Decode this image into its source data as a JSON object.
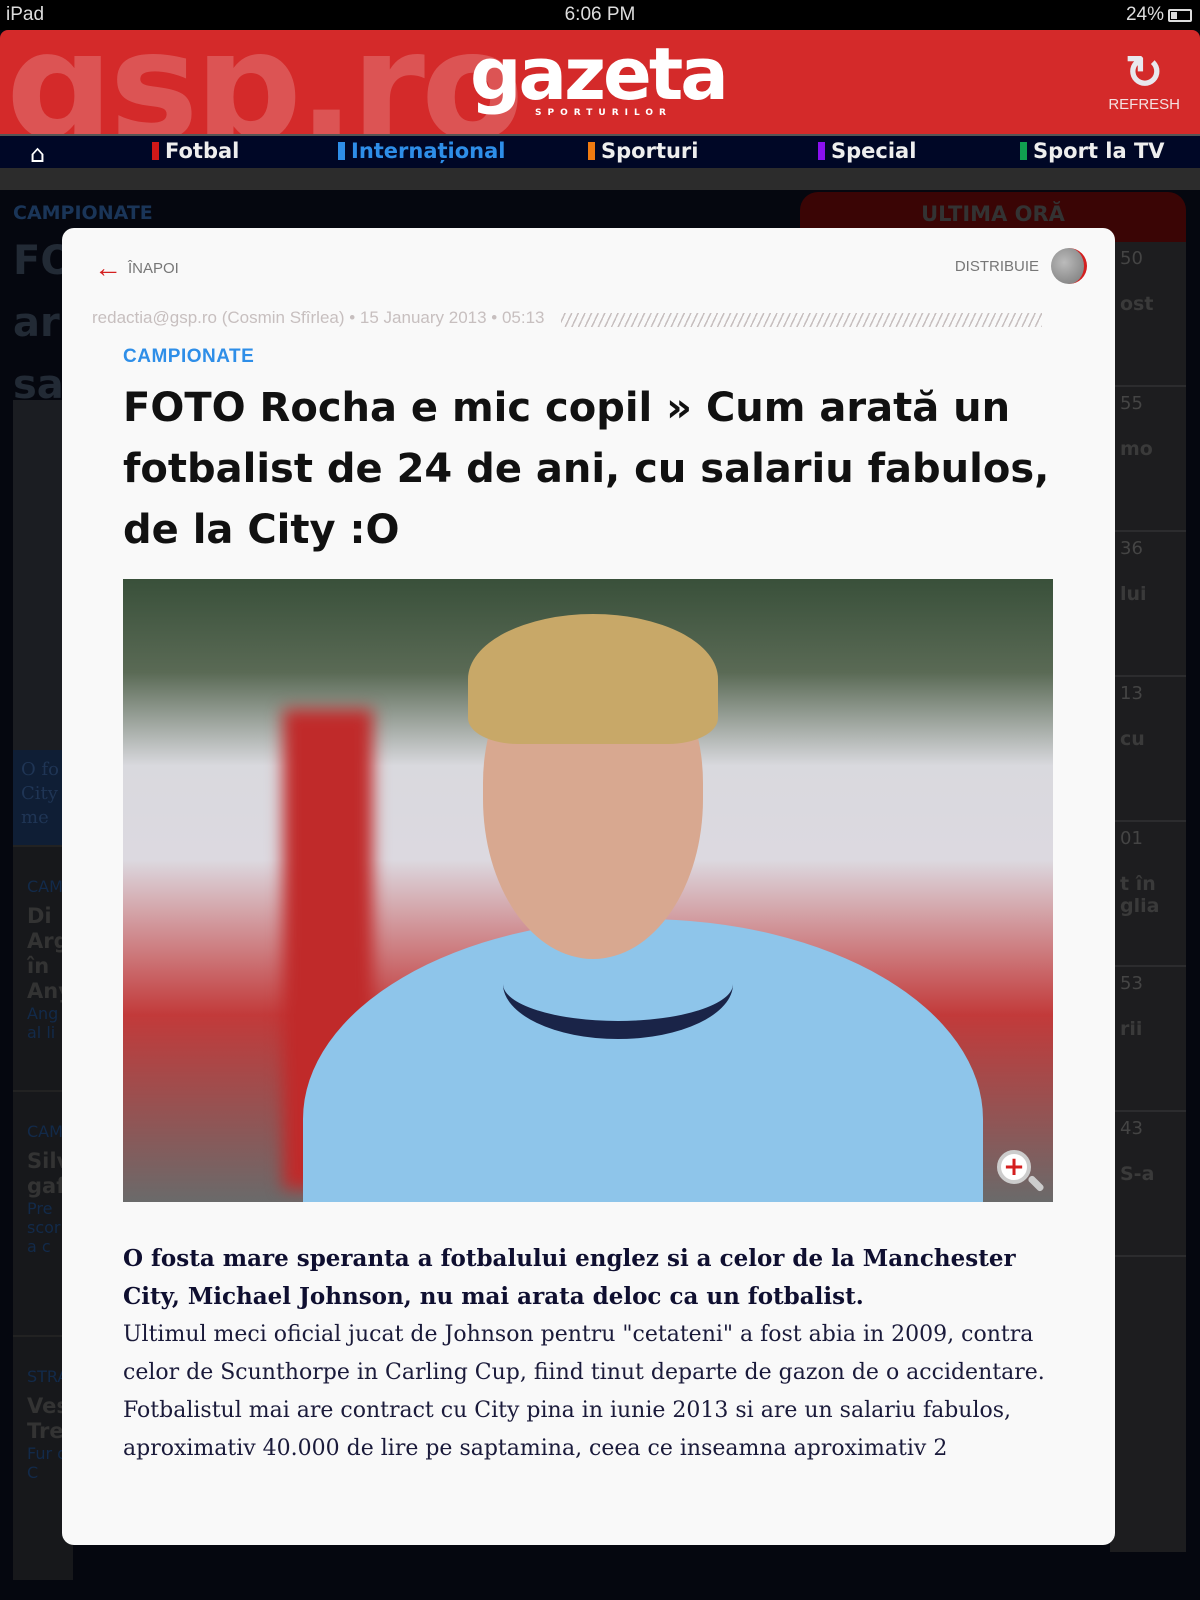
{
  "status": {
    "device": "iPad",
    "time": "6:06 PM",
    "battery": "24%"
  },
  "header": {
    "watermark": "gsp.ro",
    "logo": "gazeta",
    "logo_sub": "SPORTURILOR",
    "refresh_label": "REFRESH"
  },
  "nav": {
    "items": [
      {
        "label": "Fotbal",
        "color": "#d01818"
      },
      {
        "label": "Internațional",
        "color": "#2e8ee8"
      },
      {
        "label": "Sporturi",
        "color": "#f07a10"
      },
      {
        "label": "Special",
        "color": "#8a10f0"
      },
      {
        "label": "Sport la TV",
        "color": "#10a050"
      }
    ]
  },
  "background": {
    "category": "CAMPIONATE",
    "title": "FO\nar\nsa",
    "ultima_ora": "ULTIMA ORĂ",
    "latest": [
      {
        "time": "50",
        "text": "ost"
      },
      {
        "time": "55",
        "text": "mo"
      },
      {
        "time": "36",
        "text": "lui"
      },
      {
        "time": "13",
        "text": "cu"
      },
      {
        "time": "01",
        "text": "t în glia"
      },
      {
        "time": "53",
        "text": "rii"
      },
      {
        "time": "43",
        "text": "S-a"
      }
    ],
    "caption": "O fo City me",
    "list": [
      {
        "cat": "CAM",
        "title": "Di Arg în Any",
        "text": "Ang al li"
      },
      {
        "cat": "CAM",
        "title": "Silv gaf",
        "text": "Pre scor -a c"
      },
      {
        "cat": "STRA",
        "title": "Ves Tre",
        "text": "Fur o, C"
      }
    ]
  },
  "article": {
    "back_label": "ÎNAPOI",
    "share_label": "DISTRIBUIE",
    "meta": "redactia@gsp.ro (Cosmin Sfîrlea) • 15 January 2013 • 05:13",
    "category": "CAMPIONATE",
    "title": "FOTO Rocha e mic copil » Cum arată un fotbalist de 24 de ani, cu salariu fabulos, de la City :O",
    "lede": "O fosta mare speranta a fotbalului englez si a celor de la Manchester City, Michael Johnson, nu mai arata deloc ca un fotbalist.",
    "paragraphs": [
      "Ultimul meci oficial jucat de Johnson pentru \"cetateni\" a fost abia in 2009, contra celor de Scunthorpe in Carling Cup, fiind tinut departe de gazon de o accidentare.",
      "Fotbalistul mai are contract cu City pina in iunie 2013 si are un salariu fabulos, aproximativ 40.000 de lire pe saptamina, ceea ce inseamna aproximativ 2"
    ]
  },
  "colors": {
    "brand_red": "#d42a2a",
    "nav_bg": "#000726",
    "category_blue": "#2e8ee8"
  }
}
